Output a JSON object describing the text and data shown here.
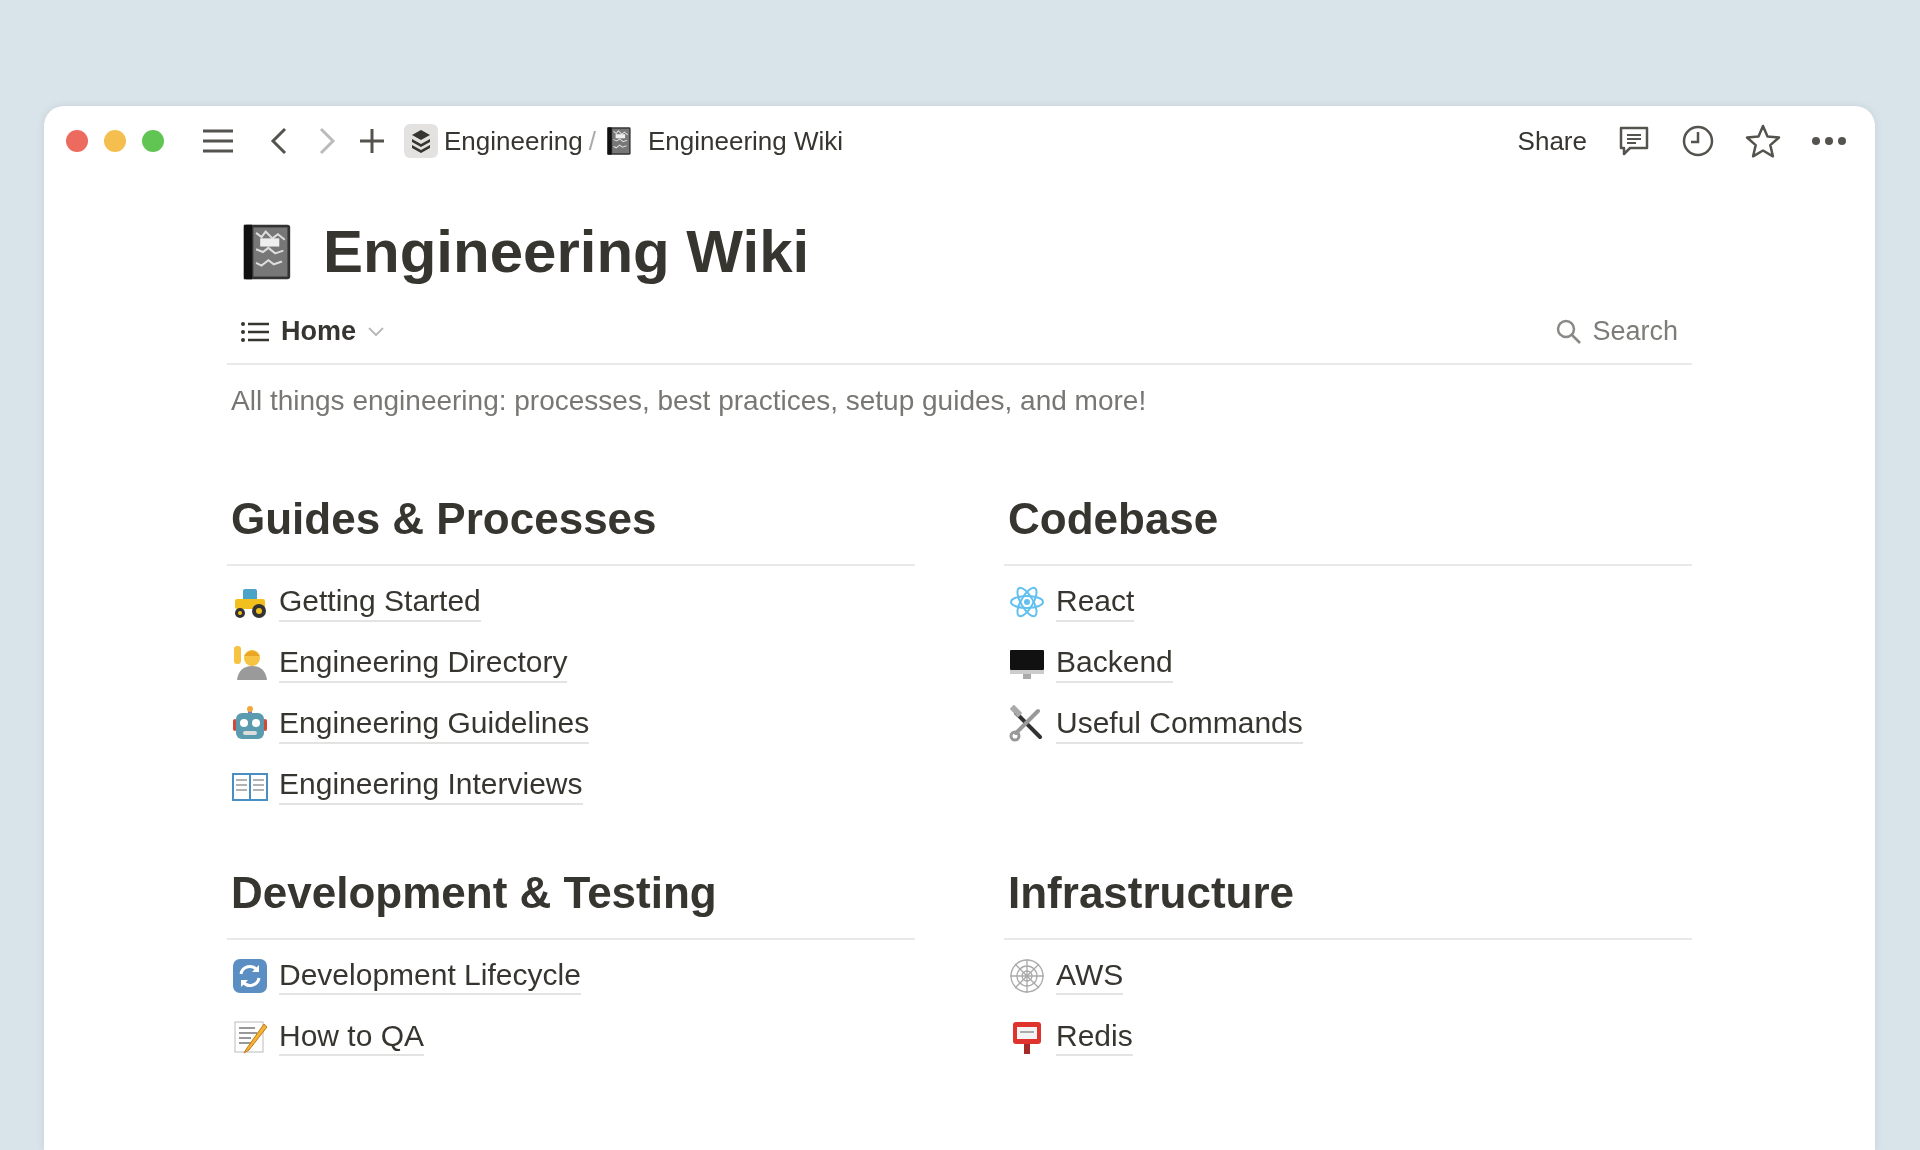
{
  "breadcrumbs": [
    {
      "label": "Engineering"
    },
    {
      "label": "Engineering Wiki"
    }
  ],
  "breadcrumb_separator": "/",
  "actions": {
    "share": "Share"
  },
  "page": {
    "title": "Engineering Wiki",
    "view": "Home",
    "search": "Search",
    "description": "All things engineering: processes, best practices, setup guides, and more!"
  },
  "sections": [
    {
      "heading": "Guides & Processes",
      "items": [
        {
          "label": "Getting Started"
        },
        {
          "label": "Engineering Directory"
        },
        {
          "label": "Engineering Guidelines"
        },
        {
          "label": "Engineering Interviews"
        }
      ]
    },
    {
      "heading": "Codebase",
      "items": [
        {
          "label": "React"
        },
        {
          "label": "Backend"
        },
        {
          "label": "Useful Commands"
        }
      ]
    },
    {
      "heading": "Development & Testing",
      "items": [
        {
          "label": "Development Lifecycle"
        },
        {
          "label": "How to QA"
        }
      ]
    },
    {
      "heading": "Infrastructure",
      "items": [
        {
          "label": "AWS"
        },
        {
          "label": "Redis"
        }
      ]
    }
  ]
}
